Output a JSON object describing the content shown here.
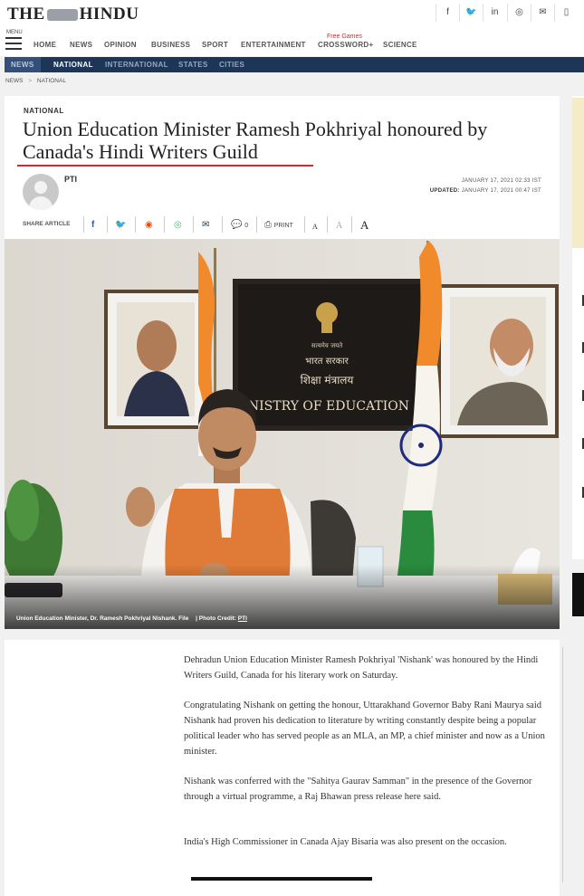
{
  "header": {
    "logo_text_left": "THE",
    "logo_text_right": "HINDU",
    "social_icons": [
      {
        "name": "facebook-icon",
        "glyph": "f"
      },
      {
        "name": "twitter-icon",
        "glyph": "🐦"
      },
      {
        "name": "linkedin-icon",
        "glyph": "in"
      },
      {
        "name": "instagram-icon",
        "glyph": "◎"
      },
      {
        "name": "email-icon",
        "glyph": "✉"
      },
      {
        "name": "mobile-icon",
        "glyph": "▯"
      }
    ],
    "menu_label": "MENU",
    "nav": [
      "HOME",
      "NEWS",
      "OPINION",
      "BUSINESS",
      "SPORT",
      "ENTERTAINMENT",
      "CROSSWORD+",
      "SCIENCE"
    ],
    "free_games_label": "Free Games"
  },
  "subnav": [
    "NEWS",
    "NATIONAL",
    "INTERNATIONAL",
    "STATES",
    "CITIES"
  ],
  "breadcrumb": {
    "parent": "NEWS",
    "separator": ">",
    "current": "NATIONAL"
  },
  "article": {
    "section": "NATIONAL",
    "headline": "Union Education Minister Ramesh Pokhriyal honoured by Canada's Hindi Writers Guild",
    "author": "PTI",
    "published": "JANUARY 17, 2021 02:33 IST",
    "updated_label": "UPDATED:",
    "updated": "JANUARY 17, 2021 00:47 IST",
    "share_label": "SHARE ARTICLE",
    "comment_count": "0",
    "print_label": "PRINT",
    "font_size_labels": [
      "A",
      "A",
      "A"
    ],
    "image_sign_lines": [
      "सत्यमेव जयते",
      "भारत सरकार",
      "शिक्षा मंत्रालय",
      "MINISTRY OF EDUCATION"
    ],
    "image_caption_text": "Union Education Minister, Dr. Ramesh Pokhriyal Nishank. File",
    "image_caption_credit_label": "| Photo Credit:",
    "image_caption_credit": "PTI",
    "paragraphs": [
      "Dehradun Union Education Minister Ramesh Pokhriyal 'Nishank' was honoured by the Hindi Writers Guild, Canada for his literary work on Saturday.",
      "Congratulating Nishank on getting the honour, Uttarakhand Governor Baby Rani Maurya said Nishank had proven his dedication to literature by writing constantly despite being a popular political leader who has served people as an MLA, an MP, a chief minister and now as a Union minister.",
      "Nishank was conferred with the \"Sahitya Gaurav Samman\" in the presence of the Governor through a virtual programme, a Raj Bhawan press release here said.",
      "India's High Commissioner in Canada Ajay Bisaria was also present on the occasion."
    ]
  },
  "colors": {
    "brand_red": "#e2232a",
    "subnav_bg": "#1d3557"
  }
}
